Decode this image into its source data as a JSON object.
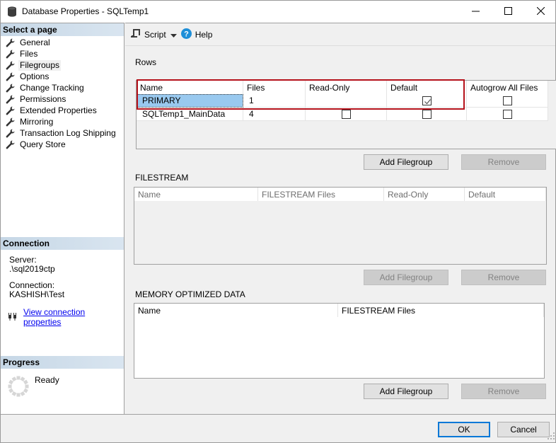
{
  "window": {
    "title": "Database Properties - SQLTemp1",
    "icon": "database-icon",
    "controls": {
      "minimize": "minimize-icon",
      "maximize": "maximize-icon",
      "close": "close-icon"
    }
  },
  "sidebar": {
    "select_page_header": "Select a page",
    "items": [
      {
        "label": "General",
        "icon": "wrench-icon",
        "selected": false
      },
      {
        "label": "Files",
        "icon": "wrench-icon",
        "selected": false
      },
      {
        "label": "Filegroups",
        "icon": "wrench-icon",
        "selected": true
      },
      {
        "label": "Options",
        "icon": "wrench-icon",
        "selected": false
      },
      {
        "label": "Change Tracking",
        "icon": "wrench-icon",
        "selected": false
      },
      {
        "label": "Permissions",
        "icon": "wrench-icon",
        "selected": false
      },
      {
        "label": "Extended Properties",
        "icon": "wrench-icon",
        "selected": false
      },
      {
        "label": "Mirroring",
        "icon": "wrench-icon",
        "selected": false
      },
      {
        "label": "Transaction Log Shipping",
        "icon": "wrench-icon",
        "selected": false
      },
      {
        "label": "Query Store",
        "icon": "wrench-icon",
        "selected": false
      }
    ],
    "connection": {
      "header": "Connection",
      "server_label": "Server:",
      "server_value": ".\\sql2019ctp",
      "connection_label": "Connection:",
      "connection_value": "KASHISH\\Test",
      "link_label": "View connection properties",
      "link_icon": "plug-icon"
    },
    "progress": {
      "header": "Progress",
      "status": "Ready",
      "icon": "spinner-icon"
    }
  },
  "toolbar": {
    "script_label": "Script",
    "script_icon": "script-icon",
    "dropdown_icon": "caret-down-icon",
    "help_label": "Help",
    "help_icon": "help-icon"
  },
  "rows_section": {
    "label": "Rows",
    "columns": [
      "Name",
      "Files",
      "Read-Only",
      "Default",
      "Autogrow All Files"
    ],
    "rows": [
      {
        "name": "PRIMARY",
        "files": "1",
        "read_only": null,
        "default": true,
        "autogrow": false,
        "selected": true
      },
      {
        "name": "SQLTemp1_MainData",
        "files": "4",
        "read_only": false,
        "default": false,
        "autogrow": false,
        "selected": false
      }
    ],
    "add_button": "Add Filegroup",
    "remove_button": "Remove",
    "add_enabled": true,
    "remove_enabled": false
  },
  "filestream_section": {
    "label": "FILESTREAM",
    "columns": [
      "Name",
      "FILESTREAM Files",
      "Read-Only",
      "Default"
    ],
    "rows": [],
    "add_button": "Add Filegroup",
    "remove_button": "Remove",
    "add_enabled": false,
    "remove_enabled": false
  },
  "memory_section": {
    "label": "MEMORY OPTIMIZED DATA",
    "columns": [
      "Name",
      "FILESTREAM Files"
    ],
    "rows": [],
    "add_button": "Add Filegroup",
    "remove_button": "Remove",
    "add_enabled": true,
    "remove_enabled": false
  },
  "footer": {
    "ok_label": "OK",
    "cancel_label": "Cancel"
  },
  "colors": {
    "highlight_border": "#b5121b",
    "selection": "#99c9ef",
    "section_header": "#c6d7e6",
    "default_button_border": "#0078d7",
    "link": "#0000ee"
  }
}
